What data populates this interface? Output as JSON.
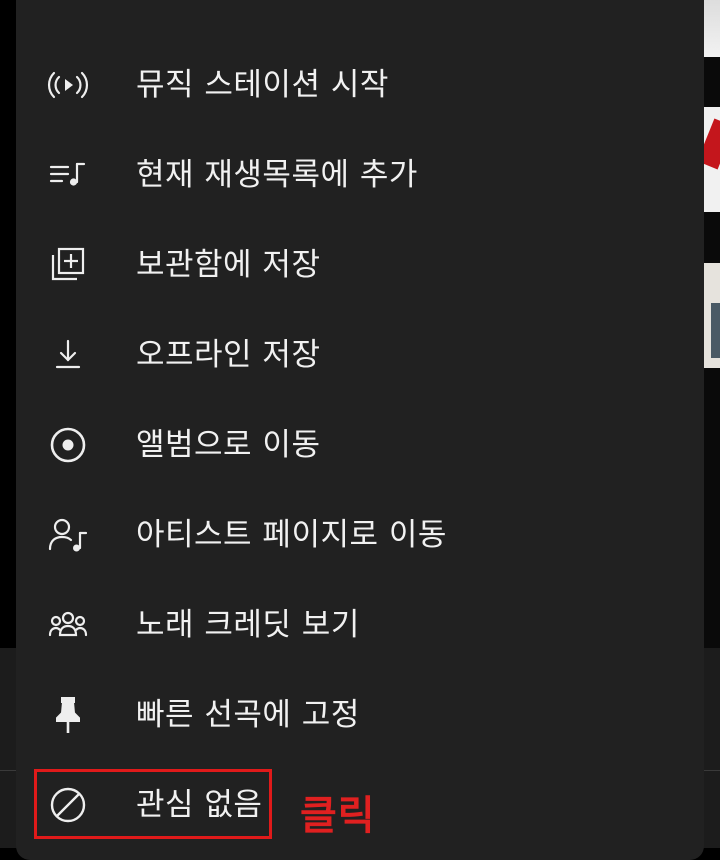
{
  "menu": {
    "items": [
      {
        "label": "뮤직 스테이션 시작",
        "icon": "radio-broadcast-icon"
      },
      {
        "label": "현재 재생목록에 추가",
        "icon": "add-to-queue-icon"
      },
      {
        "label": "보관함에 저장",
        "icon": "library-add-icon"
      },
      {
        "label": "오프라인 저장",
        "icon": "download-icon"
      },
      {
        "label": "앨범으로 이동",
        "icon": "album-icon"
      },
      {
        "label": "아티스트 페이지로 이동",
        "icon": "artist-icon"
      },
      {
        "label": "노래 크레딧 보기",
        "icon": "people-icon"
      },
      {
        "label": "빠른 선곡에 고정",
        "icon": "pin-icon"
      },
      {
        "label": "관심 없음",
        "icon": "not-interested-icon"
      }
    ]
  },
  "annotation": {
    "text": "클릭",
    "color": "#e01a1a"
  }
}
